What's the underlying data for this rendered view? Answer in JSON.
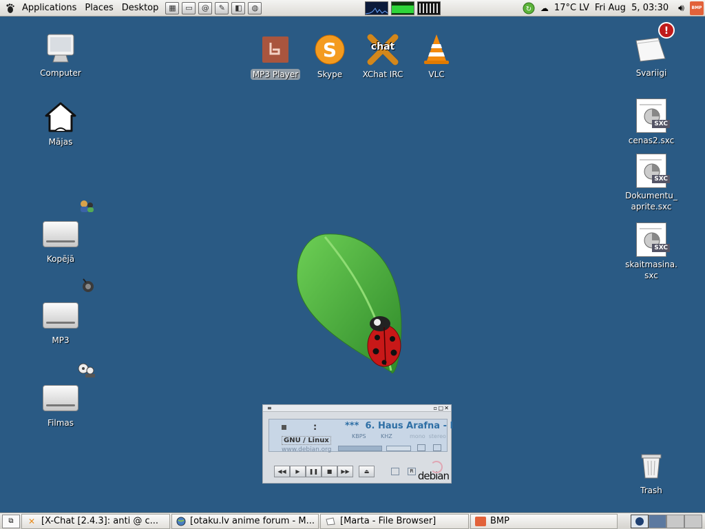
{
  "top_panel": {
    "menus": [
      "Applications",
      "Places",
      "Desktop"
    ],
    "weather": "17°C LV",
    "clock": "Fri Aug  5, 03:30",
    "tray_bmp": "BMP"
  },
  "desktop": {
    "left_icons": [
      {
        "label": "Computer"
      },
      {
        "label": "Mājas"
      },
      {
        "label": "Kopējā"
      },
      {
        "label": "MP3"
      },
      {
        "label": "Filmas"
      }
    ],
    "top_icons": [
      {
        "label": "MP3 Player"
      },
      {
        "label": "Skype"
      },
      {
        "label": "XChat IRC"
      },
      {
        "label": "VLC"
      }
    ],
    "right_icons": [
      {
        "label": "Svariigi"
      },
      {
        "label": "cenas2.sxc"
      },
      {
        "label": "Dokumentu_\naprite.sxc"
      },
      {
        "label": "skaitmasina.\nsxc"
      },
      {
        "label": "Trash"
      }
    ],
    "sxc_tag": "SXC",
    "xchat_logo": "chat"
  },
  "player": {
    "song": "***  6. Haus Arafna - I",
    "time": ":",
    "kbps": "KBPS",
    "khz": "KHZ",
    "mono_stereo": "mono  stereo",
    "gnu": "GNU / Linux",
    "url": "www.debian.org",
    "brand": "debian"
  },
  "taskbar": {
    "tasks": [
      {
        "label": "[X-Chat [2.4.3]: anti @ c..."
      },
      {
        "label": "[otaku.lv anime forum - M..."
      },
      {
        "label": "[Marta - File Browser]"
      },
      {
        "label": "BMP"
      }
    ]
  },
  "colors": {
    "desktop_bg": "#2a5a84",
    "leaf": "#4aa33b",
    "ladybug": "#c81818"
  }
}
